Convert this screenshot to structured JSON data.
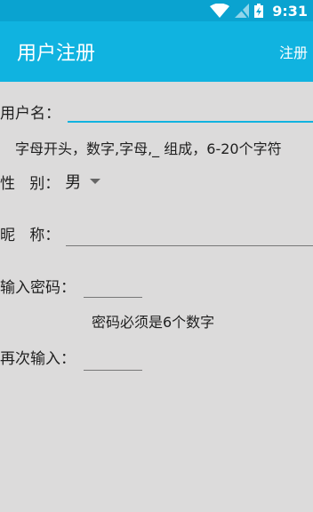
{
  "status": {
    "time": "9:31"
  },
  "header": {
    "title": "用户注册",
    "action_label": "注册"
  },
  "form": {
    "username": {
      "label": "用户名：",
      "value": "",
      "hint": "字母开头，数字,字母,_ 组成，6-20个字符"
    },
    "gender": {
      "label": "性   别：",
      "selected": "男"
    },
    "nickname": {
      "label": "昵   称：",
      "value": ""
    },
    "password": {
      "label": "输入密码：",
      "value": "",
      "hint": "密码必须是6个数字"
    },
    "confirm": {
      "label": "再次输入：",
      "value": ""
    }
  },
  "colors": {
    "status_bar": "#0aa3d0",
    "app_bar": "#10b3e0",
    "background": "#dcdbdb",
    "focus_line": "#10b3e0"
  }
}
